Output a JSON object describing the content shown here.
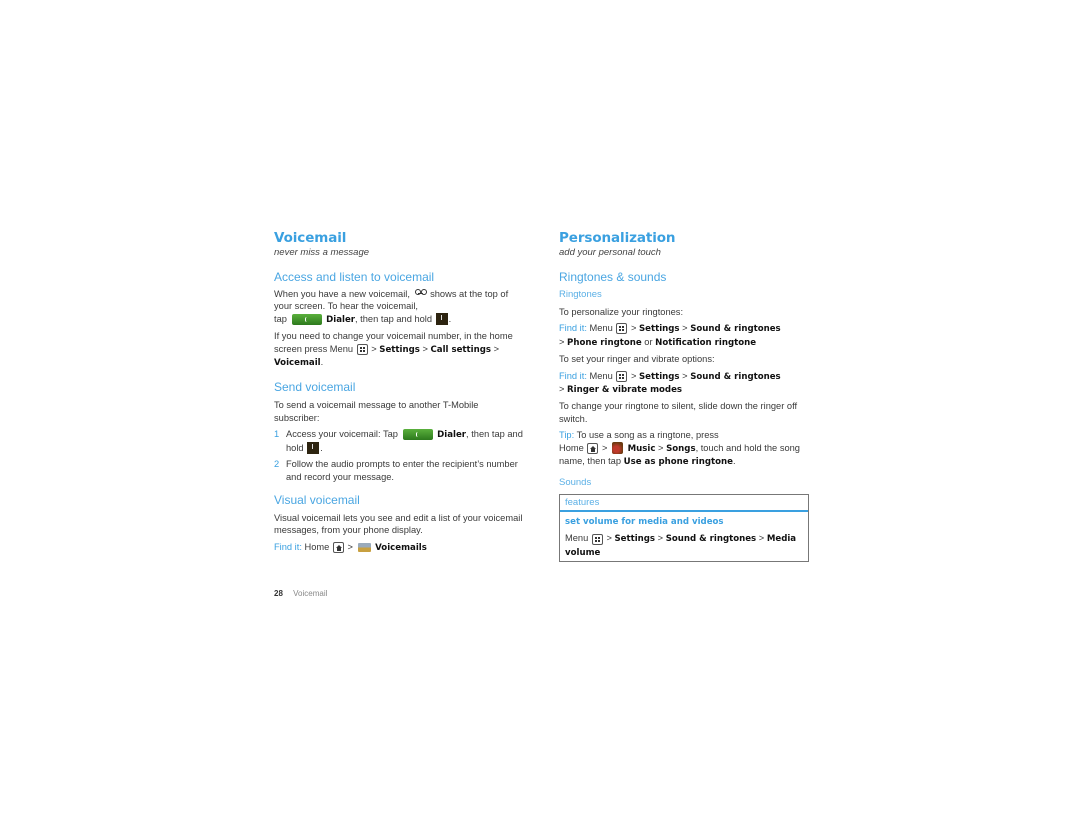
{
  "left": {
    "title": "Voicemail",
    "tagline": "never miss a message",
    "access": {
      "heading": "Access and listen to voicemail",
      "p1_a": "When you have a new voicemail,",
      "p1_b": "shows at the top of your screen. To hear the voicemail,",
      "p1_c": "tap",
      "dialer": "Dialer",
      "p1_d": ", then tap and hold",
      "p1_e": ".",
      "p2_a": "If you need to change your voicemail number, in the home screen press Menu",
      "gt": ">",
      "settings": "Settings",
      "call_settings": "Call settings",
      "voicemail": "Voicemail",
      "p2_end": "."
    },
    "send": {
      "heading": "Send voicemail",
      "intro": "To send a voicemail message to another T-Mobile subscriber:",
      "steps": [
        {
          "num": "1",
          "a": "Access your voicemail: Tap",
          "dialer": "Dialer",
          "b": ", then tap and hold",
          "c": "."
        },
        {
          "num": "2",
          "text": "Follow the audio prompts to enter the recipient’s number and record your message."
        }
      ]
    },
    "visual": {
      "heading": "Visual voicemail",
      "body": "Visual voicemail lets you see and edit a list of your voicemail messages, from your phone display.",
      "find_label": "Find it:",
      "home": "Home",
      "voicemails": "Voicemails"
    }
  },
  "right": {
    "title": "Personalization",
    "tagline": "add your personal touch",
    "ringtones_sounds": {
      "heading": "Ringtones & sounds",
      "ringtones_sub": "Ringtones",
      "p1": "To personalize your ringtones:",
      "find_label": "Find it:",
      "menu": "Menu",
      "settings": "Settings",
      "sound_ringtones": "Sound & ringtones",
      "phone_ringtone": "Phone ringtone",
      "or": "or",
      "notification_ringtone": "Notification ringtone",
      "p2": "To set your ringer and vibrate options:",
      "ringer_modes": "Ringer & vibrate modes",
      "p3": "To change your ringtone to silent, slide down the ringer off switch.",
      "tip_label": "Tip:",
      "tip_a": "To use a song as a ringtone, press",
      "home": "Home",
      "music": "Music",
      "songs": "Songs",
      "tip_b": ", touch and hold the song name, then tap",
      "use_as": "Use as phone ringtone",
      "tip_end": ".",
      "sounds_sub": "Sounds"
    },
    "feature_box": {
      "head": "features",
      "title": "set volume for media and videos",
      "menu": "Menu",
      "settings": "Settings",
      "sound_ringtones": "Sound & ringtones",
      "media_volume": "Media volume"
    }
  },
  "footer": {
    "page_number": "28",
    "section": "Voicemail"
  }
}
